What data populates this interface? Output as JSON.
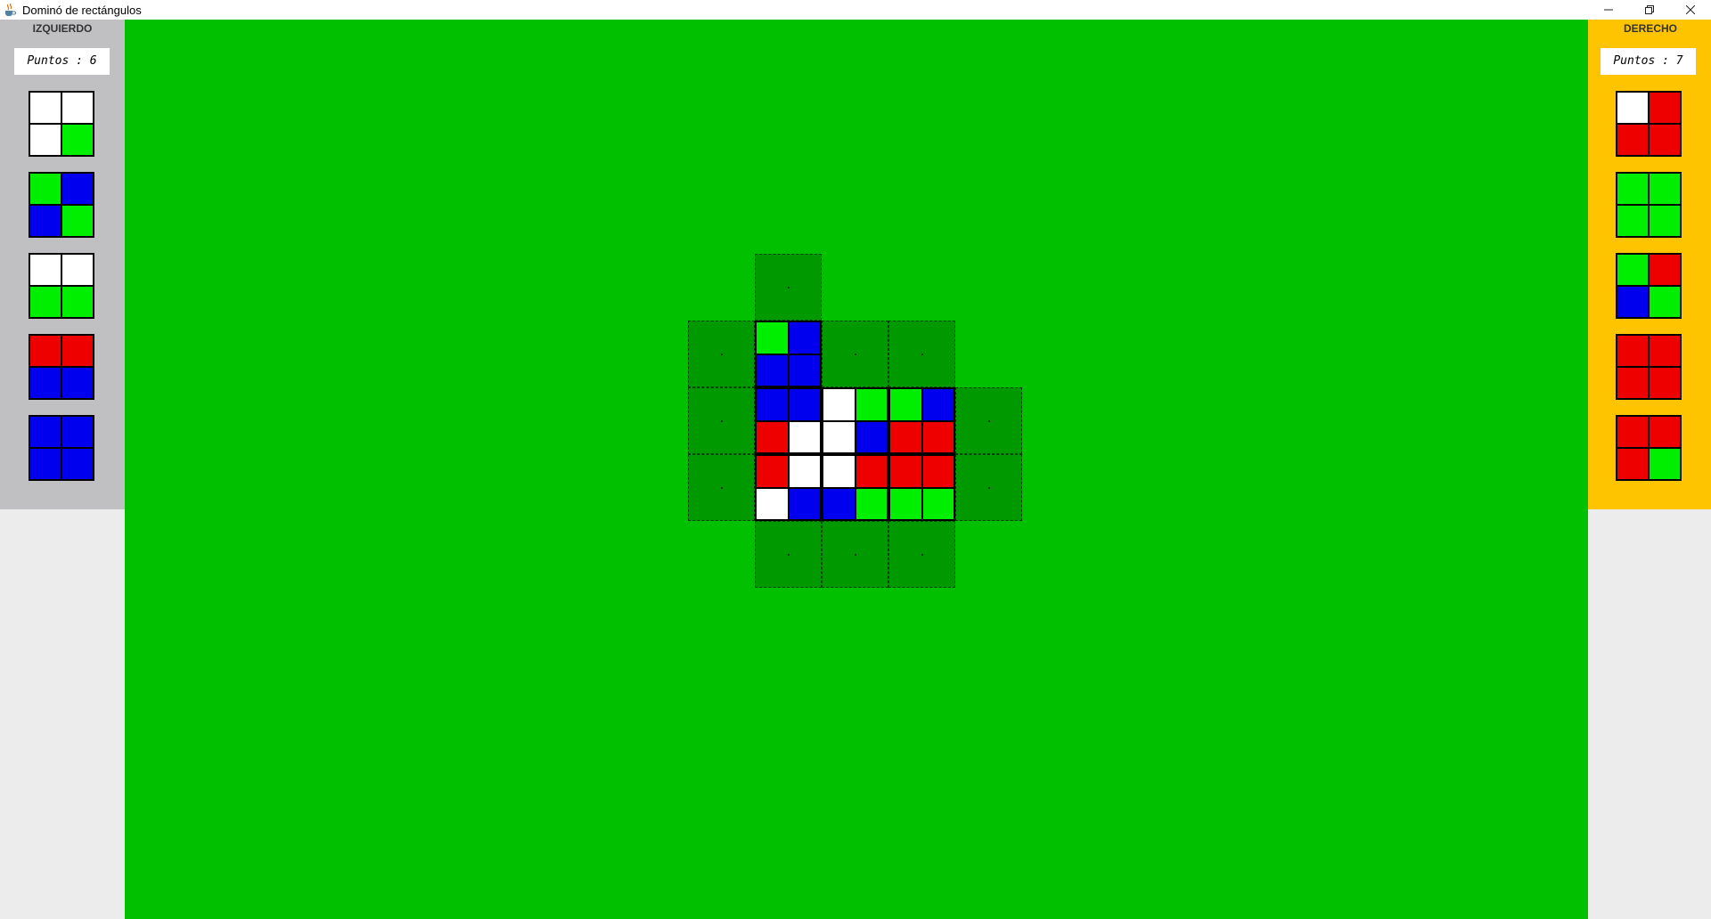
{
  "window": {
    "title": "Dominó de rectángulos",
    "icon": "java-cup-icon",
    "controls": [
      "minimize",
      "restore",
      "close"
    ]
  },
  "colors": {
    "white": "#ffffff",
    "green": "#00ee00",
    "blue": "#0000ee",
    "red": "#ee0000",
    "board": "#00c000",
    "slot": "#009a00",
    "left_panel": "#c0c0c2",
    "right_panel": "#ffc400"
  },
  "left_player": {
    "name": "IZQUIERDO",
    "score_label": "Puntos : 6",
    "hand": [
      [
        "white",
        "white",
        "white",
        "green"
      ],
      [
        "green",
        "blue",
        "blue",
        "green"
      ],
      [
        "white",
        "white",
        "green",
        "green"
      ],
      [
        "red",
        "red",
        "blue",
        "blue"
      ],
      [
        "blue",
        "blue",
        "blue",
        "blue"
      ]
    ]
  },
  "right_player": {
    "name": "DERECHO",
    "score_label": "Puntos : 7",
    "hand": [
      [
        "white",
        "red",
        "red",
        "red"
      ],
      [
        "green",
        "green",
        "green",
        "green"
      ],
      [
        "green",
        "red",
        "blue",
        "green"
      ],
      [
        "red",
        "red",
        "red",
        "red"
      ],
      [
        "red",
        "red",
        "red",
        "green"
      ]
    ]
  },
  "board": {
    "grid_note": "columns 0-4 / rows 0-4 of the tile grid",
    "placed_tiles": [
      {
        "col": 1,
        "row": 1,
        "cells": [
          "green",
          "blue",
          "blue",
          "blue"
        ]
      },
      {
        "col": 1,
        "row": 2,
        "cells": [
          "blue",
          "blue",
          "red",
          "white"
        ]
      },
      {
        "col": 2,
        "row": 2,
        "cells": [
          "white",
          "green",
          "white",
          "blue"
        ]
      },
      {
        "col": 3,
        "row": 2,
        "cells": [
          "green",
          "blue",
          "red",
          "red"
        ]
      },
      {
        "col": 1,
        "row": 3,
        "cells": [
          "red",
          "white",
          "white",
          "blue"
        ]
      },
      {
        "col": 2,
        "row": 3,
        "cells": [
          "white",
          "red",
          "blue",
          "green"
        ]
      },
      {
        "col": 3,
        "row": 3,
        "cells": [
          "red",
          "red",
          "green",
          "green"
        ]
      }
    ],
    "open_slots": [
      {
        "col": 1,
        "row": 0
      },
      {
        "col": 0,
        "row": 1
      },
      {
        "col": 2,
        "row": 1
      },
      {
        "col": 3,
        "row": 1
      },
      {
        "col": 0,
        "row": 2
      },
      {
        "col": 4,
        "row": 2
      },
      {
        "col": 0,
        "row": 3
      },
      {
        "col": 4,
        "row": 3
      },
      {
        "col": 1,
        "row": 4
      },
      {
        "col": 2,
        "row": 4
      },
      {
        "col": 3,
        "row": 4
      }
    ]
  }
}
